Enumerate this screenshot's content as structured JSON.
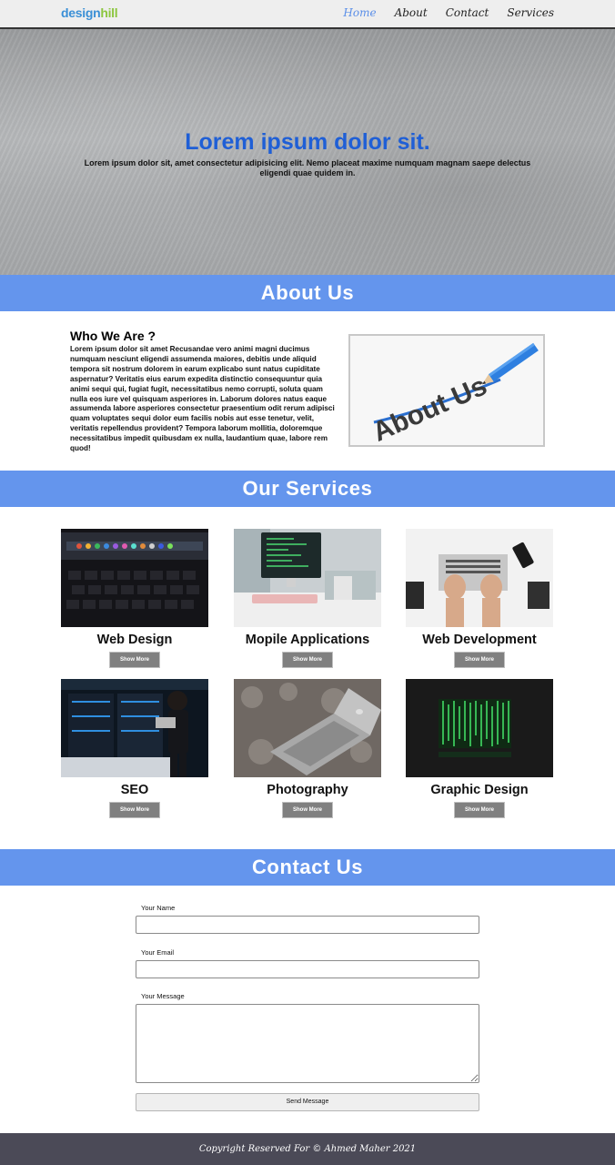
{
  "nav": {
    "logo_part1": "design",
    "logo_part2": "hill",
    "links": [
      "Home",
      "About",
      "Contact",
      "Services"
    ]
  },
  "hero": {
    "title": "Lorem ipsum dolor sit.",
    "subtitle": "Lorem ipsum dolor sit, amet consectetur adipisicing elit. Nemo placeat maxime numquam magnam saepe delectus eligendi quae quidem in."
  },
  "about": {
    "section_title": "About Us",
    "heading": "Who We Are ?",
    "paragraph": "Lorem ipsum dolor sit amet Recusandae vero animi magni ducimus numquam nesciunt eligendi assumenda maiores, debitis unde aliquid tempora sit nostrum dolorem in earum explicabo sunt natus cupiditate aspernatur? Veritatis eius earum expedita distinctio consequuntur quia animi sequi qui, fugiat fugit, necessitatibus nemo corrupti, soluta quam nulla eos iure vel quisquam asperiores in. Laborum dolores natus eaque assumenda labore asperiores consectetur praesentium odit rerum adipisci quam voluptates sequi dolor eum facilis nobis aut esse tenetur, velit, veritatis repellendus provident? Tempora laborum mollitia, doloremque necessitatibus impedit quibusdam ex nulla, laudantium quae, labore rem quod!",
    "image_text": "About Us"
  },
  "services": {
    "section_title": "Our Services",
    "button_label": "Show More",
    "items": [
      {
        "title": "Web Design"
      },
      {
        "title": "Mopile Applications"
      },
      {
        "title": "Web Development"
      },
      {
        "title": "SEO"
      },
      {
        "title": "Photography"
      },
      {
        "title": "Graphic Design"
      }
    ]
  },
  "contact": {
    "section_title": "Contact Us",
    "name_label": "Your Name",
    "email_label": "Your Email",
    "message_label": "Your Message",
    "name_value": "",
    "email_value": "",
    "message_value": "",
    "send_label": "Send Message"
  },
  "footer": {
    "text": "Copyright Reserved For © Ahmed Maher 2021"
  },
  "colors": {
    "accent_bar": "#6495ed",
    "hero_title": "#1f5fd6",
    "footer_bg": "#4b4a57",
    "nav_active": "#5b8fe8"
  }
}
